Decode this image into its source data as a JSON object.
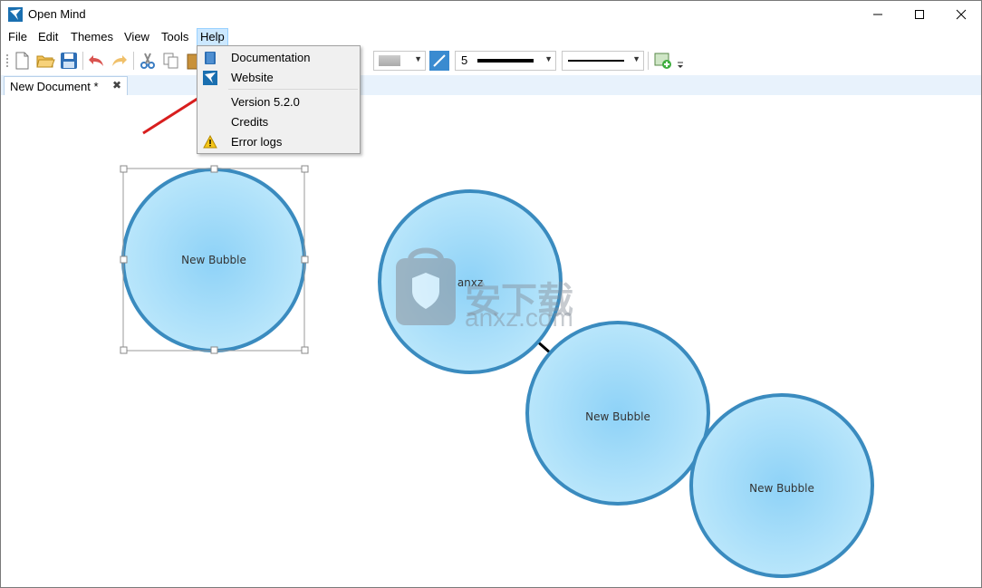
{
  "window": {
    "title": "Open Mind"
  },
  "menubar": {
    "items": [
      "File",
      "Edit",
      "Themes",
      "View",
      "Tools",
      "Help"
    ]
  },
  "toolbar": {
    "line_width": "5"
  },
  "tabs": [
    {
      "label": "New Document *"
    }
  ],
  "help_menu": {
    "items": [
      {
        "label": "Documentation",
        "icon": "book-icon"
      },
      {
        "label": "Website",
        "icon": "website-icon"
      },
      {
        "label": "Version 5.2.0",
        "icon": ""
      },
      {
        "label": "Credits",
        "icon": ""
      },
      {
        "label": "Error logs",
        "icon": "warning-icon"
      }
    ]
  },
  "bubbles": [
    {
      "label": "New Bubble",
      "selected": true
    },
    {
      "label": "anxz",
      "selected": false
    },
    {
      "label": "New Bubble",
      "selected": false
    },
    {
      "label": "New Bubble",
      "selected": false
    }
  ],
  "watermark": {
    "text": "安下载",
    "url": "anxz.com"
  },
  "colors": {
    "bubble_fill": "#a9dcf8",
    "bubble_stroke": "#3a8bbf",
    "accent": "#0078d7",
    "menu_highlight": "#cce8ff"
  }
}
